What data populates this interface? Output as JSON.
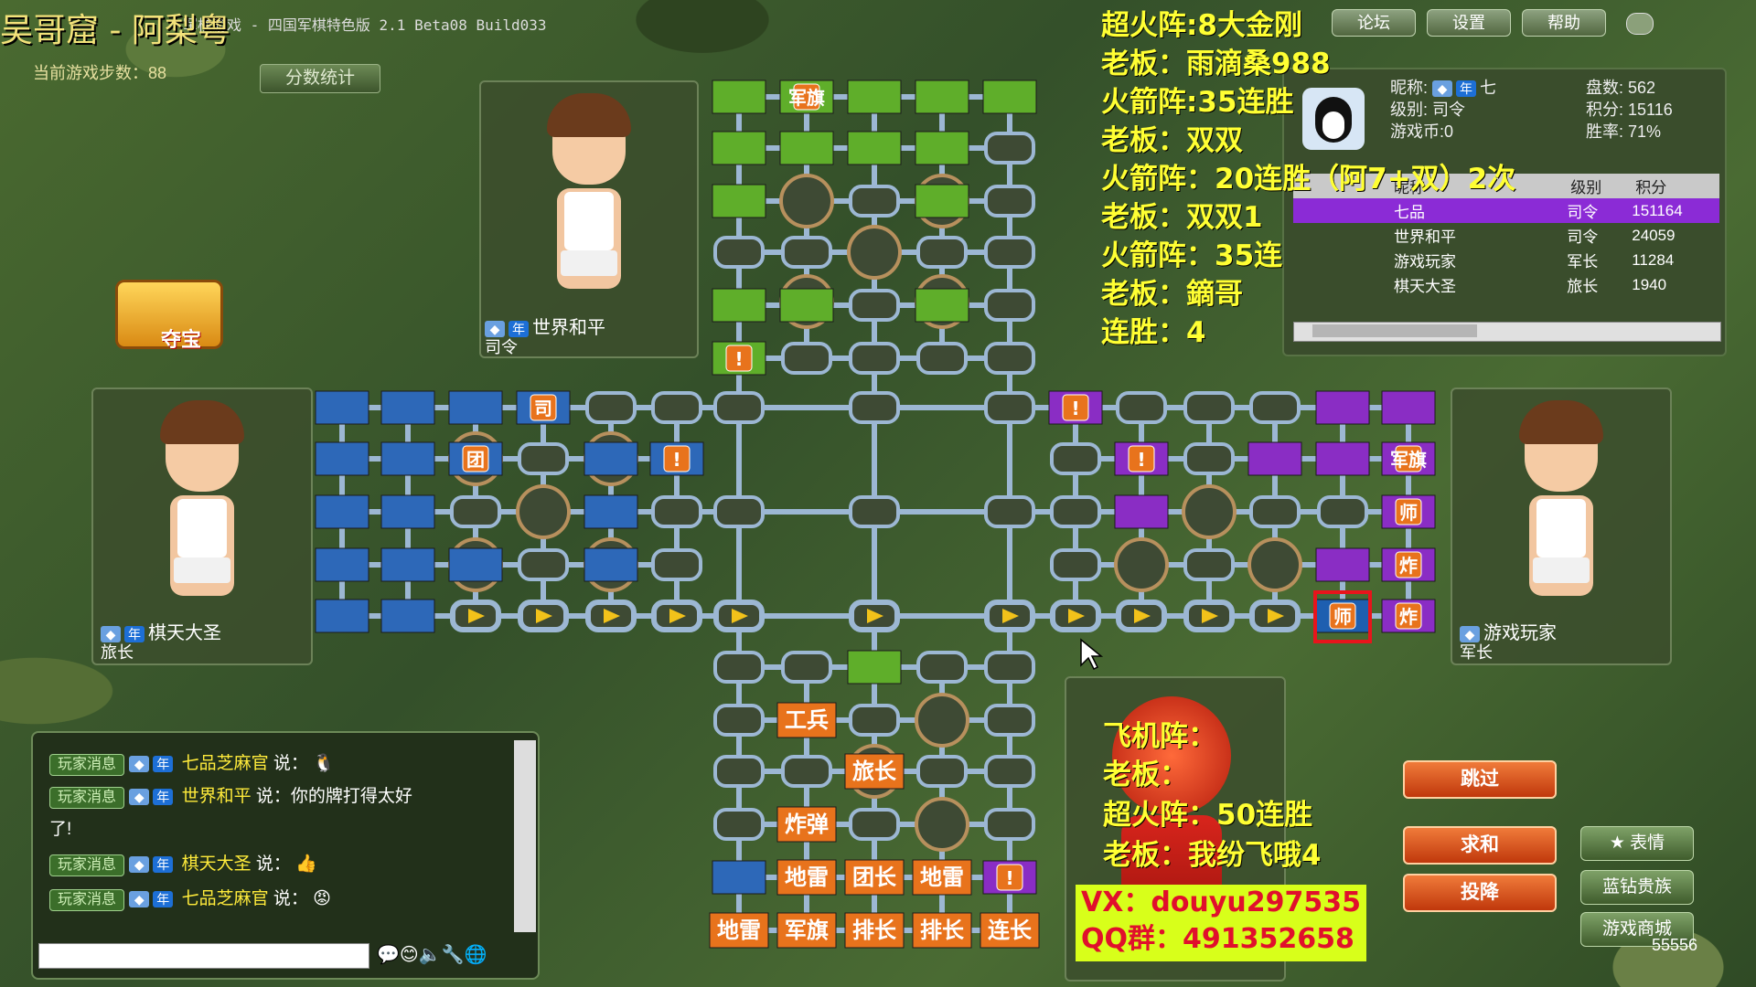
{
  "window": {
    "title_overlay": "吴哥窟 - 阿梨粤",
    "title_text": "军棋游戏 - 四国军棋特色版 2.1 Beta08 Build033",
    "buttons": [
      "论坛",
      "设置",
      "帮助"
    ]
  },
  "status": {
    "steps_label": "当前游戏步数：88",
    "score_button": "分数统计"
  },
  "overlay_text": [
    "超火阵:8大金刚",
    "老板：雨滴桑988",
    "火箭阵:35连胜",
    "老板：双双",
    "火箭阵：20连胜（阿7+双）2次",
    "老板：双双1",
    "火箭阵：35连",
    "老板：鏑哥",
    "连胜：4"
  ],
  "overlay_text_2": [
    "飞机阵：",
    "老板：",
    "超火阵：50连胜",
    "老板：我纷飞哦4"
  ],
  "treasure_label": "夺宝",
  "players": {
    "top": {
      "name": "世界和平",
      "rank": "司令"
    },
    "left": {
      "name": "棋天大圣",
      "rank": "旅长"
    },
    "right": {
      "name": "游戏玩家",
      "rank": "军长"
    }
  },
  "info": {
    "nickname_label": "昵称:",
    "nickname": "七",
    "level_label": "级别: 司令",
    "coins_label": "游戏币:0",
    "games_label": "盘数: 562",
    "points_label": "积分: 15116",
    "winrate_label": "胜率: 71%"
  },
  "player_list": {
    "headers": [
      "昵称",
      "级别",
      "积分"
    ],
    "rows": [
      {
        "name": "七品",
        "level": "司令",
        "points": "151164"
      },
      {
        "name": "世界和平",
        "level": "司令",
        "points": "24059"
      },
      {
        "name": "游戏玩家",
        "level": "军长",
        "points": "11284"
      },
      {
        "name": "棋天大圣",
        "level": "旅长",
        "points": "1940"
      }
    ]
  },
  "board": {
    "green_labels": [
      "军旗"
    ],
    "blue_labels": [
      "司",
      "团"
    ],
    "purple_labels": [
      "军旗",
      "师",
      "炸",
      "师",
      "炸"
    ],
    "orange_labels": [
      "工兵",
      "旅长",
      "炸弹",
      "地雷",
      "团长",
      "地雷",
      "地雷",
      "军旗",
      "排长",
      "排长",
      "连长"
    ],
    "mark": "!"
  },
  "chat": {
    "tag": "玩家消息",
    "lines": [
      {
        "name": "七品芝麻官",
        "text": "说："
      },
      {
        "name": "世界和平",
        "text": "说：你的牌打得太好"
      },
      {
        "name": "",
        "text": "了!"
      },
      {
        "name": "棋天大圣",
        "text": "说："
      },
      {
        "name": "七品芝麻官",
        "text": "说："
      }
    ]
  },
  "actions": {
    "skip": "跳过",
    "draw": "求和",
    "surrender": "投降",
    "emote": "表情",
    "blue": "蓝钻贵族",
    "mall": "游戏商城"
  },
  "contact": {
    "vx": "VX：douyu297535",
    "qq": "QQ群：491352658"
  },
  "watermark": "55556"
}
